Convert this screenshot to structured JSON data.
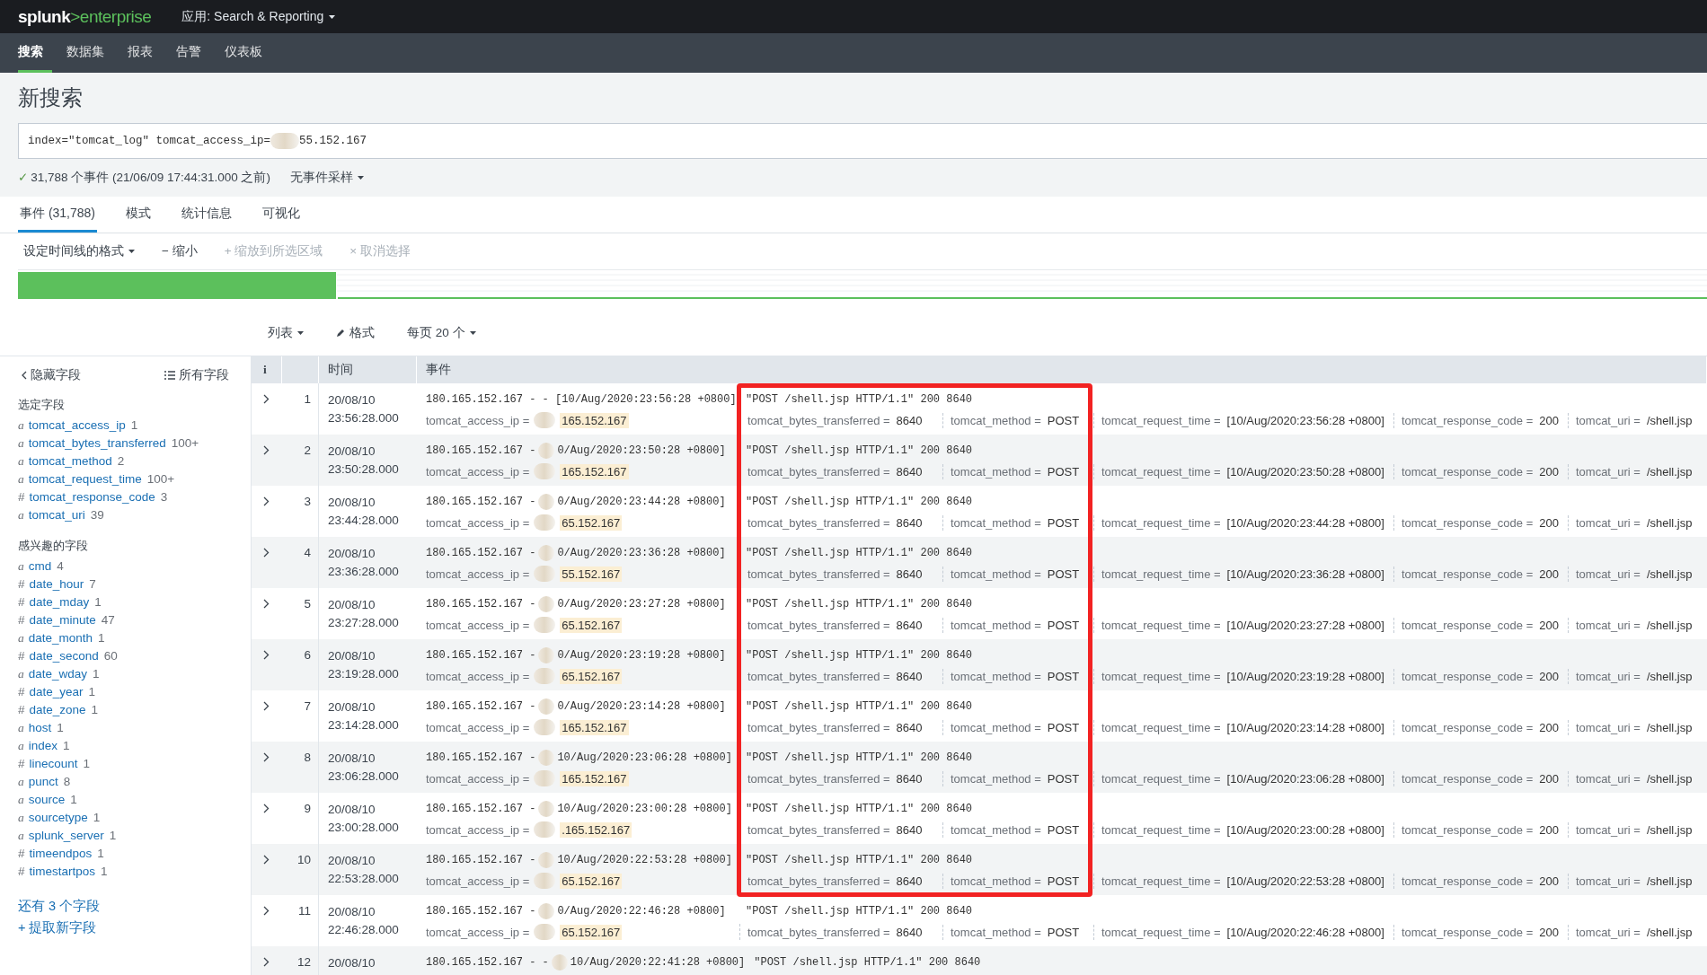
{
  "header": {
    "logo": {
      "brand": "splunk",
      "chevron": ">",
      "product": "enterprise"
    },
    "app_menu": "应用: Search & Reporting"
  },
  "nav": [
    {
      "label": "搜索",
      "selected": true
    },
    {
      "label": "数据集",
      "selected": false
    },
    {
      "label": "报表",
      "selected": false
    },
    {
      "label": "告警",
      "selected": false
    },
    {
      "label": "仪表板",
      "selected": false
    }
  ],
  "page_title": "新搜索",
  "search": {
    "value_before": "index=\"tomcat_log\" tomcat_access_ip=",
    "value_after": "55.152.167",
    "redacted": true
  },
  "status": {
    "check": "✓",
    "text": "31,788 个事件 (21/06/09 17:44:31.000 之前)",
    "sampling": "无事件采样"
  },
  "result_tabs": [
    {
      "label": "事件 (31,788)",
      "selected": true
    },
    {
      "label": "模式",
      "selected": false
    },
    {
      "label": "统计信息",
      "selected": false
    },
    {
      "label": "可视化",
      "selected": false
    }
  ],
  "timeline_controls": [
    {
      "label": "设定时间线的格式",
      "dropdown": true,
      "disabled": false
    },
    {
      "icon": "−",
      "label": "缩小",
      "dropdown": false,
      "disabled": false
    },
    {
      "icon": "+",
      "label": "缩放到所选区域",
      "dropdown": false,
      "disabled": true
    },
    {
      "icon": "×",
      "label": "取消选择",
      "dropdown": false,
      "disabled": true
    }
  ],
  "list_controls": [
    {
      "kind": "dropdown",
      "label": "列表"
    },
    {
      "kind": "format",
      "label": "格式"
    },
    {
      "kind": "dropdown",
      "label": "每页 20 个"
    }
  ],
  "sidebar": {
    "hide_fields": "隐藏字段",
    "all_fields": "所有字段",
    "sections": [
      {
        "title": "选定字段",
        "fields": [
          {
            "type": "a",
            "name": "tomcat_access_ip",
            "count": "1"
          },
          {
            "type": "a",
            "name": "tomcat_bytes_transferred",
            "count": "100+"
          },
          {
            "type": "a",
            "name": "tomcat_method",
            "count": "2"
          },
          {
            "type": "a",
            "name": "tomcat_request_time",
            "count": "100+"
          },
          {
            "type": "#",
            "name": "tomcat_response_code",
            "count": "3"
          },
          {
            "type": "a",
            "name": "tomcat_uri",
            "count": "39"
          }
        ]
      },
      {
        "title": "感兴趣的字段",
        "fields": [
          {
            "type": "a",
            "name": "cmd",
            "count": "4"
          },
          {
            "type": "#",
            "name": "date_hour",
            "count": "7"
          },
          {
            "type": "#",
            "name": "date_mday",
            "count": "1"
          },
          {
            "type": "#",
            "name": "date_minute",
            "count": "47"
          },
          {
            "type": "a",
            "name": "date_month",
            "count": "1"
          },
          {
            "type": "#",
            "name": "date_second",
            "count": "60"
          },
          {
            "type": "a",
            "name": "date_wday",
            "count": "1"
          },
          {
            "type": "#",
            "name": "date_year",
            "count": "1"
          },
          {
            "type": "#",
            "name": "date_zone",
            "count": "1"
          },
          {
            "type": "a",
            "name": "host",
            "count": "1"
          },
          {
            "type": "a",
            "name": "index",
            "count": "1"
          },
          {
            "type": "#",
            "name": "linecount",
            "count": "1"
          },
          {
            "type": "a",
            "name": "punct",
            "count": "8"
          },
          {
            "type": "a",
            "name": "source",
            "count": "1"
          },
          {
            "type": "a",
            "name": "sourcetype",
            "count": "1"
          },
          {
            "type": "a",
            "name": "splunk_server",
            "count": "1"
          },
          {
            "type": "#",
            "name": "timeendpos",
            "count": "1"
          },
          {
            "type": "#",
            "name": "timestartpos",
            "count": "1"
          }
        ]
      }
    ],
    "more_fields": "还有 3 个字段",
    "extract": "+ 提取新字段"
  },
  "table": {
    "columns": [
      "i",
      "",
      "时间",
      "事件"
    ],
    "rows": [
      {
        "num": "1",
        "date": "20/08/10",
        "time": "23:56:28.000",
        "raw_before": "180.165.152.167 - - [10/Aug/2020:23:56:28 +0800]",
        "raw_redacted": false,
        "raw_after": "\"POST /shell.jsp HTTP/1.1\" 200 8640",
        "fields": [
          {
            "kind": "ip",
            "key": "tomcat_access_ip =",
            "value": "165.152.167"
          },
          {
            "kind": "bytes",
            "key": "tomcat_bytes_transferred =",
            "value": "8640"
          },
          {
            "kind": "method",
            "key": "tomcat_method =",
            "value": "POST"
          },
          {
            "kind": "other",
            "key": "tomcat_request_time =",
            "value": "[10/Aug/2020:23:56:28 +0800]"
          },
          {
            "kind": "other",
            "key": "tomcat_response_code =",
            "value": "200"
          },
          {
            "kind": "other",
            "key": "tomcat_uri =",
            "value": "/shell.jsp"
          }
        ]
      },
      {
        "num": "2",
        "date": "20/08/10",
        "time": "23:50:28.000",
        "raw_before": "180.165.152.167 -",
        "raw_redacted": true,
        "raw_date": "0/Aug/2020:23:50:28 +0800]",
        "raw_after": "\"POST /shell.jsp HTTP/1.1\" 200 8640",
        "fields": [
          {
            "kind": "ip",
            "key": "tomcat_access_ip =",
            "value": "165.152.167"
          },
          {
            "kind": "bytes",
            "key": "tomcat_bytes_transferred =",
            "value": "8640"
          },
          {
            "kind": "method",
            "key": "tomcat_method =",
            "value": "POST"
          },
          {
            "kind": "other",
            "key": "tomcat_request_time =",
            "value": "[10/Aug/2020:23:50:28 +0800]"
          },
          {
            "kind": "other",
            "key": "tomcat_response_code =",
            "value": "200"
          },
          {
            "kind": "other",
            "key": "tomcat_uri =",
            "value": "/shell.jsp"
          }
        ]
      },
      {
        "num": "3",
        "date": "20/08/10",
        "time": "23:44:28.000",
        "raw_before": "180.165.152.167 -",
        "raw_redacted": true,
        "raw_date": "0/Aug/2020:23:44:28 +0800]",
        "raw_after": "\"POST /shell.jsp HTTP/1.1\" 200 8640",
        "fields": [
          {
            "kind": "ip",
            "key": "tomcat_access_ip =",
            "value": "65.152.167"
          },
          {
            "kind": "bytes",
            "key": "tomcat_bytes_transferred =",
            "value": "8640"
          },
          {
            "kind": "method",
            "key": "tomcat_method =",
            "value": "POST"
          },
          {
            "kind": "other",
            "key": "tomcat_request_time =",
            "value": "[10/Aug/2020:23:44:28 +0800]"
          },
          {
            "kind": "other",
            "key": "tomcat_response_code =",
            "value": "200"
          },
          {
            "kind": "other",
            "key": "tomcat_uri =",
            "value": "/shell.jsp"
          }
        ]
      },
      {
        "num": "4",
        "date": "20/08/10",
        "time": "23:36:28.000",
        "raw_before": "180.165.152.167 -",
        "raw_redacted": true,
        "raw_date": "0/Aug/2020:23:36:28 +0800]",
        "raw_after": "\"POST /shell.jsp HTTP/1.1\" 200 8640",
        "fields": [
          {
            "kind": "ip",
            "key": "tomcat_access_ip =",
            "value": "55.152.167"
          },
          {
            "kind": "bytes",
            "key": "tomcat_bytes_transferred =",
            "value": "8640"
          },
          {
            "kind": "method",
            "key": "tomcat_method =",
            "value": "POST"
          },
          {
            "kind": "other",
            "key": "tomcat_request_time =",
            "value": "[10/Aug/2020:23:36:28 +0800]"
          },
          {
            "kind": "other",
            "key": "tomcat_response_code =",
            "value": "200"
          },
          {
            "kind": "other",
            "key": "tomcat_uri =",
            "value": "/shell.jsp"
          }
        ]
      },
      {
        "num": "5",
        "date": "20/08/10",
        "time": "23:27:28.000",
        "raw_before": "180.165.152.167 -",
        "raw_redacted": true,
        "raw_date": "0/Aug/2020:23:27:28 +0800]",
        "raw_after": "\"POST /shell.jsp HTTP/1.1\" 200 8640",
        "fields": [
          {
            "kind": "ip",
            "key": "tomcat_access_ip =",
            "value": "65.152.167"
          },
          {
            "kind": "bytes",
            "key": "tomcat_bytes_transferred =",
            "value": "8640"
          },
          {
            "kind": "method",
            "key": "tomcat_method =",
            "value": "POST"
          },
          {
            "kind": "other",
            "key": "tomcat_request_time =",
            "value": "[10/Aug/2020:23:27:28 +0800]"
          },
          {
            "kind": "other",
            "key": "tomcat_response_code =",
            "value": "200"
          },
          {
            "kind": "other",
            "key": "tomcat_uri =",
            "value": "/shell.jsp"
          }
        ]
      },
      {
        "num": "6",
        "date": "20/08/10",
        "time": "23:19:28.000",
        "raw_before": "180.165.152.167 -",
        "raw_redacted": true,
        "raw_date": "0/Aug/2020:23:19:28 +0800]",
        "raw_after": "\"POST /shell.jsp HTTP/1.1\" 200 8640",
        "fields": [
          {
            "kind": "ip",
            "key": "tomcat_access_ip =",
            "value": "65.152.167"
          },
          {
            "kind": "bytes",
            "key": "tomcat_bytes_transferred =",
            "value": "8640"
          },
          {
            "kind": "method",
            "key": "tomcat_method =",
            "value": "POST"
          },
          {
            "kind": "other",
            "key": "tomcat_request_time =",
            "value": "[10/Aug/2020:23:19:28 +0800]"
          },
          {
            "kind": "other",
            "key": "tomcat_response_code =",
            "value": "200"
          },
          {
            "kind": "other",
            "key": "tomcat_uri =",
            "value": "/shell.jsp"
          }
        ]
      },
      {
        "num": "7",
        "date": "20/08/10",
        "time": "23:14:28.000",
        "raw_before": "180.165.152.167 -",
        "raw_redacted": true,
        "raw_date": "0/Aug/2020:23:14:28 +0800]",
        "raw_after": "\"POST /shell.jsp HTTP/1.1\" 200 8640",
        "fields": [
          {
            "kind": "ip",
            "key": "tomcat_access_ip =",
            "value": "165.152.167"
          },
          {
            "kind": "bytes",
            "key": "tomcat_bytes_transferred =",
            "value": "8640"
          },
          {
            "kind": "method",
            "key": "tomcat_method =",
            "value": "POST"
          },
          {
            "kind": "other",
            "key": "tomcat_request_time =",
            "value": "[10/Aug/2020:23:14:28 +0800]"
          },
          {
            "kind": "other",
            "key": "tomcat_response_code =",
            "value": "200"
          },
          {
            "kind": "other",
            "key": "tomcat_uri =",
            "value": "/shell.jsp"
          }
        ]
      },
      {
        "num": "8",
        "date": "20/08/10",
        "time": "23:06:28.000",
        "raw_before": "180.165.152.167 -",
        "raw_redacted": true,
        "raw_date": "10/Aug/2020:23:06:28 +0800]",
        "raw_after": "\"POST /shell.jsp HTTP/1.1\" 200 8640",
        "fields": [
          {
            "kind": "ip",
            "key": "tomcat_access_ip =",
            "value": "165.152.167"
          },
          {
            "kind": "bytes",
            "key": "tomcat_bytes_transferred =",
            "value": "8640"
          },
          {
            "kind": "method",
            "key": "tomcat_method =",
            "value": "POST"
          },
          {
            "kind": "other",
            "key": "tomcat_request_time =",
            "value": "[10/Aug/2020:23:06:28 +0800]"
          },
          {
            "kind": "other",
            "key": "tomcat_response_code =",
            "value": "200"
          },
          {
            "kind": "other",
            "key": "tomcat_uri =",
            "value": "/shell.jsp"
          }
        ]
      },
      {
        "num": "9",
        "date": "20/08/10",
        "time": "23:00:28.000",
        "raw_before": "180.165.152.167 -",
        "raw_redacted": true,
        "raw_date": "10/Aug/2020:23:00:28 +0800]",
        "raw_after": "\"POST /shell.jsp HTTP/1.1\" 200 8640",
        "fields": [
          {
            "kind": "ip",
            "key": "tomcat_access_ip =",
            "value": ".165.152.167"
          },
          {
            "kind": "bytes",
            "key": "tomcat_bytes_transferred =",
            "value": "8640"
          },
          {
            "kind": "method",
            "key": "tomcat_method =",
            "value": "POST"
          },
          {
            "kind": "other",
            "key": "tomcat_request_time =",
            "value": "[10/Aug/2020:23:00:28 +0800]"
          },
          {
            "kind": "other",
            "key": "tomcat_response_code =",
            "value": "200"
          },
          {
            "kind": "other",
            "key": "tomcat_uri =",
            "value": "/shell.jsp"
          }
        ]
      },
      {
        "num": "10",
        "date": "20/08/10",
        "time": "22:53:28.000",
        "raw_before": "180.165.152.167 -",
        "raw_redacted": true,
        "raw_date": "10/Aug/2020:22:53:28 +0800]",
        "raw_after": "\"POST /shell.jsp HTTP/1.1\" 200 8640",
        "fields": [
          {
            "kind": "ip",
            "key": "tomcat_access_ip =",
            "value": "65.152.167"
          },
          {
            "kind": "bytes",
            "key": "tomcat_bytes_transferred =",
            "value": "8640"
          },
          {
            "kind": "method",
            "key": "tomcat_method =",
            "value": "POST"
          },
          {
            "kind": "other",
            "key": "tomcat_request_time =",
            "value": "[10/Aug/2020:22:53:28 +0800]"
          },
          {
            "kind": "other",
            "key": "tomcat_response_code =",
            "value": "200"
          },
          {
            "kind": "other",
            "key": "tomcat_uri =",
            "value": "/shell.jsp"
          }
        ]
      },
      {
        "num": "11",
        "date": "20/08/10",
        "time": "22:46:28.000",
        "raw_before": "180.165.152.167 -",
        "raw_redacted": true,
        "raw_date": "0/Aug/2020:22:46:28 +0800]",
        "raw_after": "\"POST /shell.jsp HTTP/1.1\" 200 8640",
        "fields": [
          {
            "kind": "ip",
            "key": "tomcat_access_ip =",
            "value": "65.152.167"
          },
          {
            "kind": "bytes",
            "key": "tomcat_bytes_transferred =",
            "value": "8640"
          },
          {
            "kind": "method",
            "key": "tomcat_method =",
            "value": "POST"
          },
          {
            "kind": "other",
            "key": "tomcat_request_time =",
            "value": "[10/Aug/2020:22:46:28 +0800]"
          },
          {
            "kind": "other",
            "key": "tomcat_response_code =",
            "value": "200"
          },
          {
            "kind": "other",
            "key": "tomcat_uri =",
            "value": "/shell.jsp"
          }
        ]
      },
      {
        "num": "12",
        "date": "20/08/10",
        "raw_before": "180.165.152.167 - -",
        "raw_redacted": true,
        "raw_date": "10/Aug/2020:22:41:28 +0800]",
        "raw_after": "\"POST /shell.jsp HTTP/1.1\" 200 8640"
      }
    ]
  },
  "annotation": {
    "shown": true
  }
}
